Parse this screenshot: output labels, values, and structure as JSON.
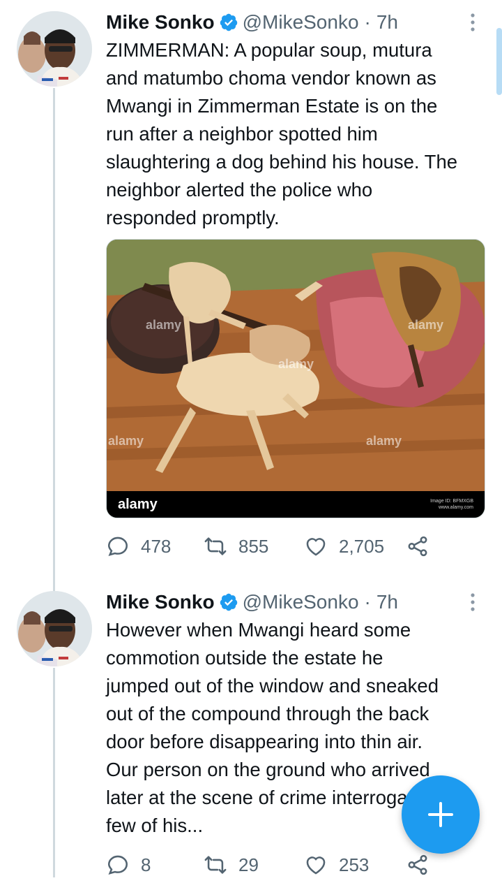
{
  "tweets": [
    {
      "name": "Mike Sonko",
      "handle": "@MikeSonko",
      "sep": "·",
      "time": "7h",
      "text": "ZIMMERMAN: A popular soup, mutura\nand matumbo choma vendor known as\nMwangi in Zimmerman Estate is on the\nrun after a neighbor spotted him\nslaughtering a dog behind his house. The\nneighbor alerted the police who\nresponded promptly.",
      "media": {
        "brand": "alamy",
        "image_id_line1": "Image ID: BFMXGB",
        "image_id_line2": "www.alamy.com",
        "watermark": "alamy"
      },
      "replies": "478",
      "retweets": "855",
      "likes": "2,705"
    },
    {
      "name": "Mike Sonko",
      "handle": "@MikeSonko",
      "sep": "·",
      "time": "7h",
      "text": "However when Mwangi heard some\ncommotion outside the estate he\njumped out of the window and sneaked\nout of the compound through the back\ndoor before disappearing into thin air.\nOur person on the ground who arrived\nlater at the scene of crime interrogated a\nfew of his...",
      "replies": "8",
      "retweets": "29",
      "likes": "253"
    }
  ],
  "colors": {
    "accent": "#1d9bf0",
    "text_primary": "#0f1419",
    "text_secondary": "#536471",
    "thread_line": "#cfd9de"
  },
  "icons": {
    "verified": "verified-badge-icon",
    "more": "more-vertical-icon",
    "reply": "reply-icon",
    "retweet": "retweet-icon",
    "like": "heart-icon",
    "share": "share-icon",
    "compose": "plus-icon"
  }
}
